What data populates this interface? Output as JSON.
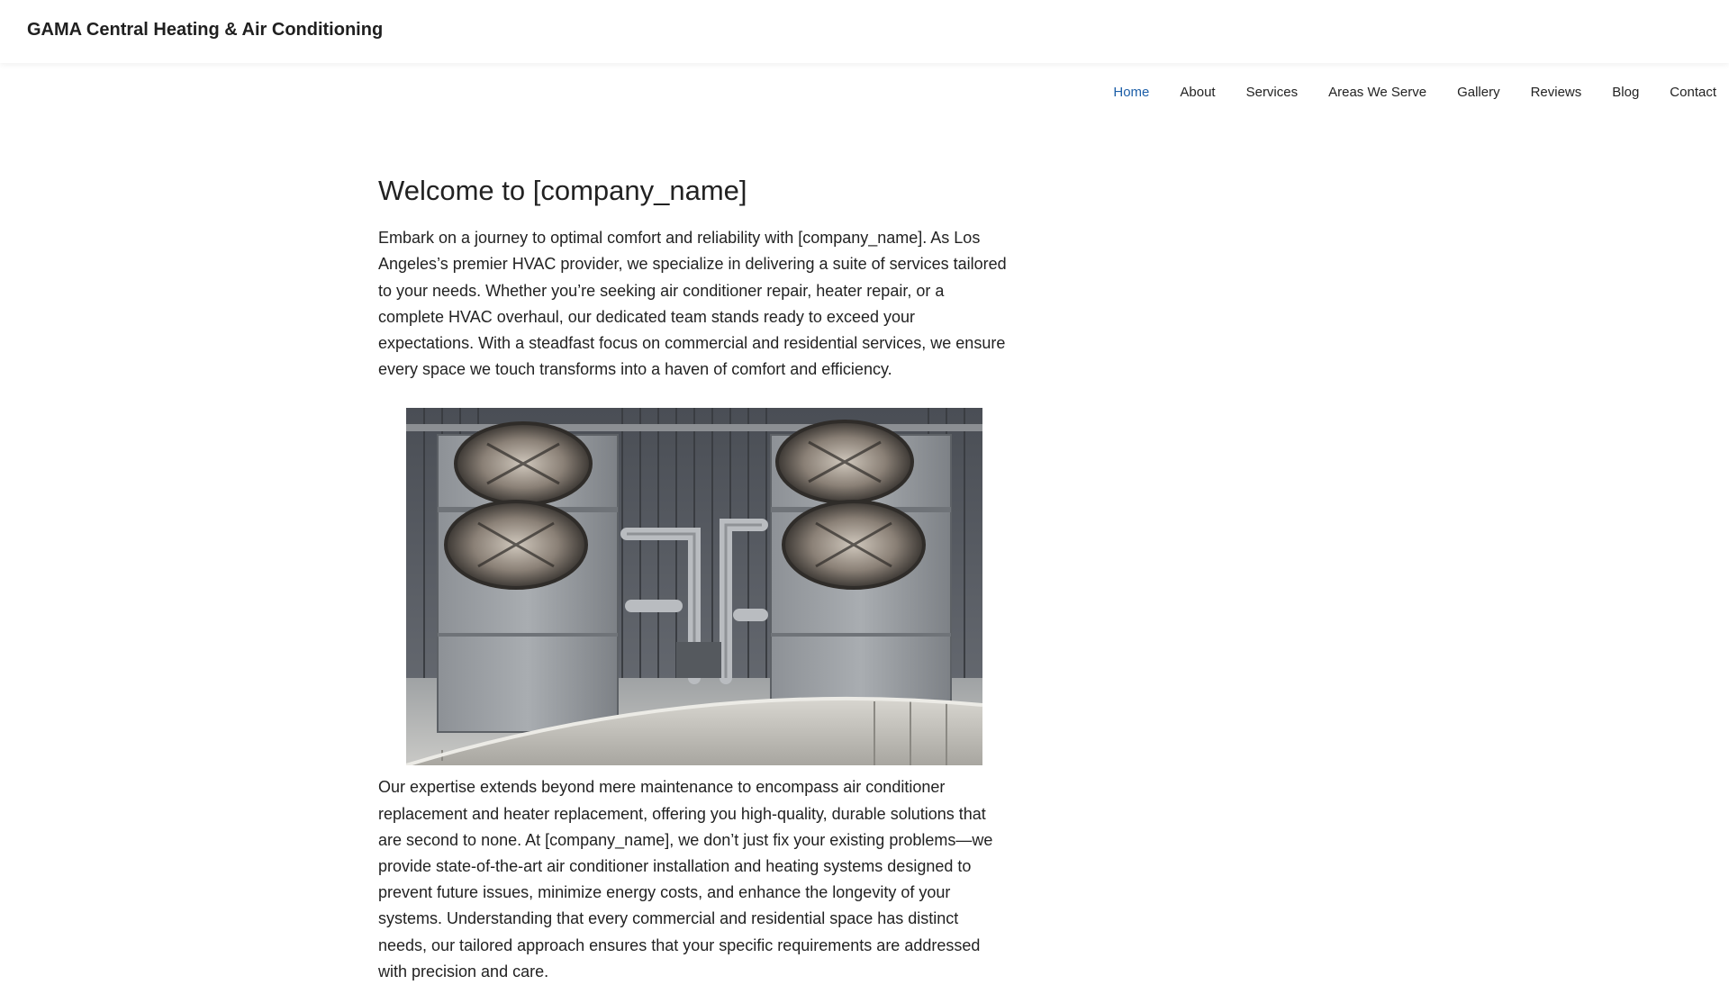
{
  "header": {
    "brand": "GAMA Central Heating & Air Conditioning"
  },
  "nav": {
    "items": [
      {
        "label": "Home",
        "active": true
      },
      {
        "label": "About"
      },
      {
        "label": "Services"
      },
      {
        "label": "Areas We Serve"
      },
      {
        "label": "Gallery"
      },
      {
        "label": "Reviews"
      },
      {
        "label": "Blog"
      },
      {
        "label": "Contact"
      }
    ],
    "active_color": "#1d5fa8"
  },
  "main": {
    "title": "Welcome to [company_name]",
    "intro": "Embark on a journey to optimal comfort and reliability with [company_name]. As Los Angeles’s premier HVAC provider, we specialize in delivering a suite of services tailored to your needs. Whether you’re seeking air conditioner repair, heater repair, or a complete HVAC overhaul, our dedicated team stands ready to exceed your expectations. With a steadfast focus on commercial and residential services, we ensure every space we touch transforms into a haven of comfort and efficiency.",
    "body": "Our expertise extends beyond mere maintenance to encompass air conditioner replacement and heater replacement, offering you high-quality, durable solutions that are second to none. At [company_name], we don’t just fix your existing problems—we provide state-of-the-art air conditioner installation and heating systems designed to prevent future issues, minimize energy costs, and enhance the longevity of your systems. Understanding that every commercial and residential space has distinct needs, our tailored approach ensures that your specific requirements are addressed with precision and care."
  }
}
